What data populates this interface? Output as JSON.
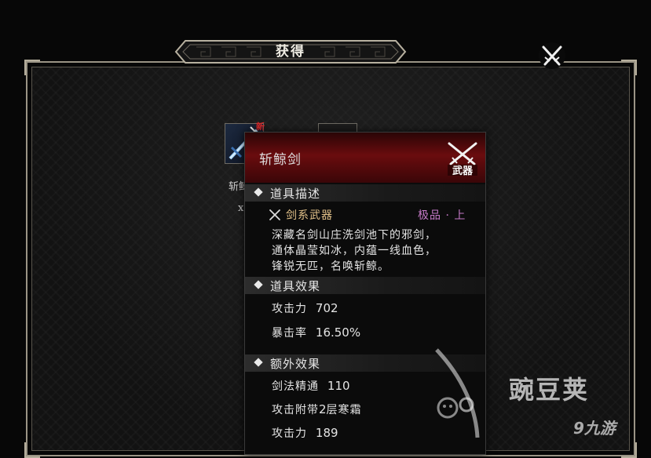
{
  "dialog": {
    "title": "获得",
    "close_icon": "crossed-swords-close-icon"
  },
  "reward_items": [
    {
      "icon": "sword-item-icon",
      "badge": "新",
      "label": "斩鲸",
      "count": "x"
    },
    {
      "icon": "item-icon",
      "label": ""
    }
  ],
  "tooltip": {
    "name": "斩鲸剑",
    "type_icon": "crossed-swords-weapon-icon",
    "type_badge_text": "武器",
    "description_header": "道具描述",
    "weapon_type": "剑系武器",
    "grade": "极品 · 上",
    "description_lines": [
      "深藏名剑山庄洗剑池下的邪剑，",
      "通体晶莹如冰，内蕴一线血色，",
      "锋锐无匹，名唤斩鲸。"
    ],
    "effect_header": "道具效果",
    "effects": [
      {
        "name": "攻击力",
        "value": "702"
      },
      {
        "name": "暴击率",
        "value": "16.50%"
      }
    ],
    "extra_header": "额外效果",
    "extras": [
      {
        "name": "剑法精通",
        "value": "110"
      },
      {
        "name": "攻击附带",
        "value": "2",
        "suffix": "层寒霜"
      },
      {
        "name": "攻击力",
        "value": "189"
      }
    ]
  },
  "watermark": {
    "text": "豌豆荚",
    "sub": "九游",
    "sub_prefix": "9"
  },
  "colors": {
    "header_red": "#6a0c0e",
    "weapon_type": "#e3c28a",
    "grade": "#c67ac8",
    "frame": "#9a9485"
  }
}
